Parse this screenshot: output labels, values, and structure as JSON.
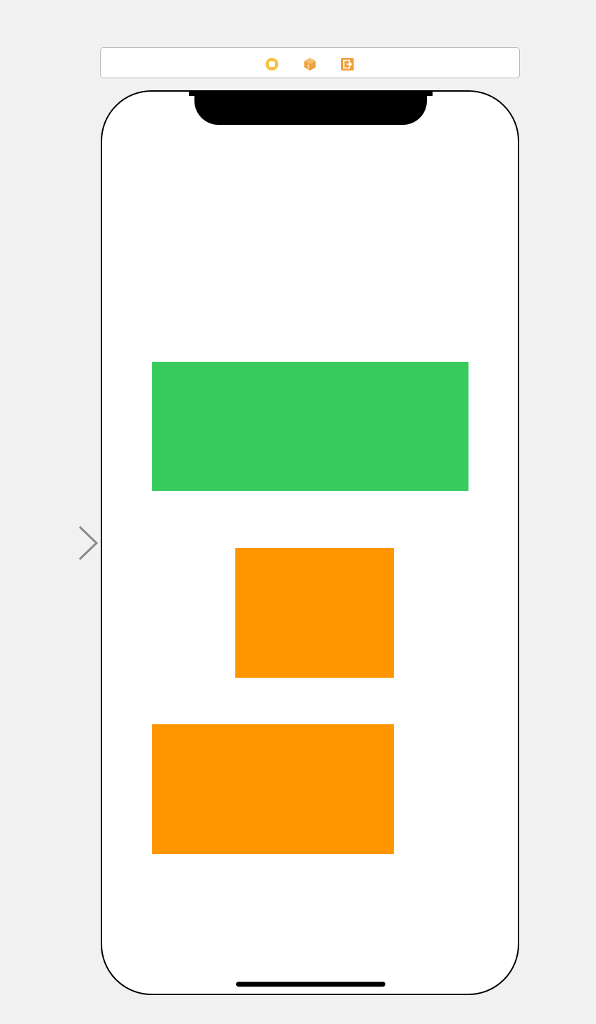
{
  "colors": {
    "canvas_background": "#f1f1f1",
    "screen_background": "#ffffff",
    "device_frame": "#000000",
    "green_view": "#37cb5d",
    "orange_view": "#ff9500",
    "dock_view_controller_icon": "#f5c342",
    "dock_first_responder_icon": "#f0a03c",
    "dock_exit_icon": "#f0a03c",
    "entry_arrow": "#8a8a8a"
  },
  "scene_dock": {
    "icons": [
      {
        "name": "view-controller-icon"
      },
      {
        "name": "first-responder-icon"
      },
      {
        "name": "exit-icon"
      }
    ]
  },
  "views": [
    {
      "name": "green-view",
      "color": "green_view"
    },
    {
      "name": "orange-view-1",
      "color": "orange_view"
    },
    {
      "name": "orange-view-2",
      "color": "orange_view"
    }
  ],
  "entry_point": {
    "icon": "entry-point-arrow-icon"
  }
}
